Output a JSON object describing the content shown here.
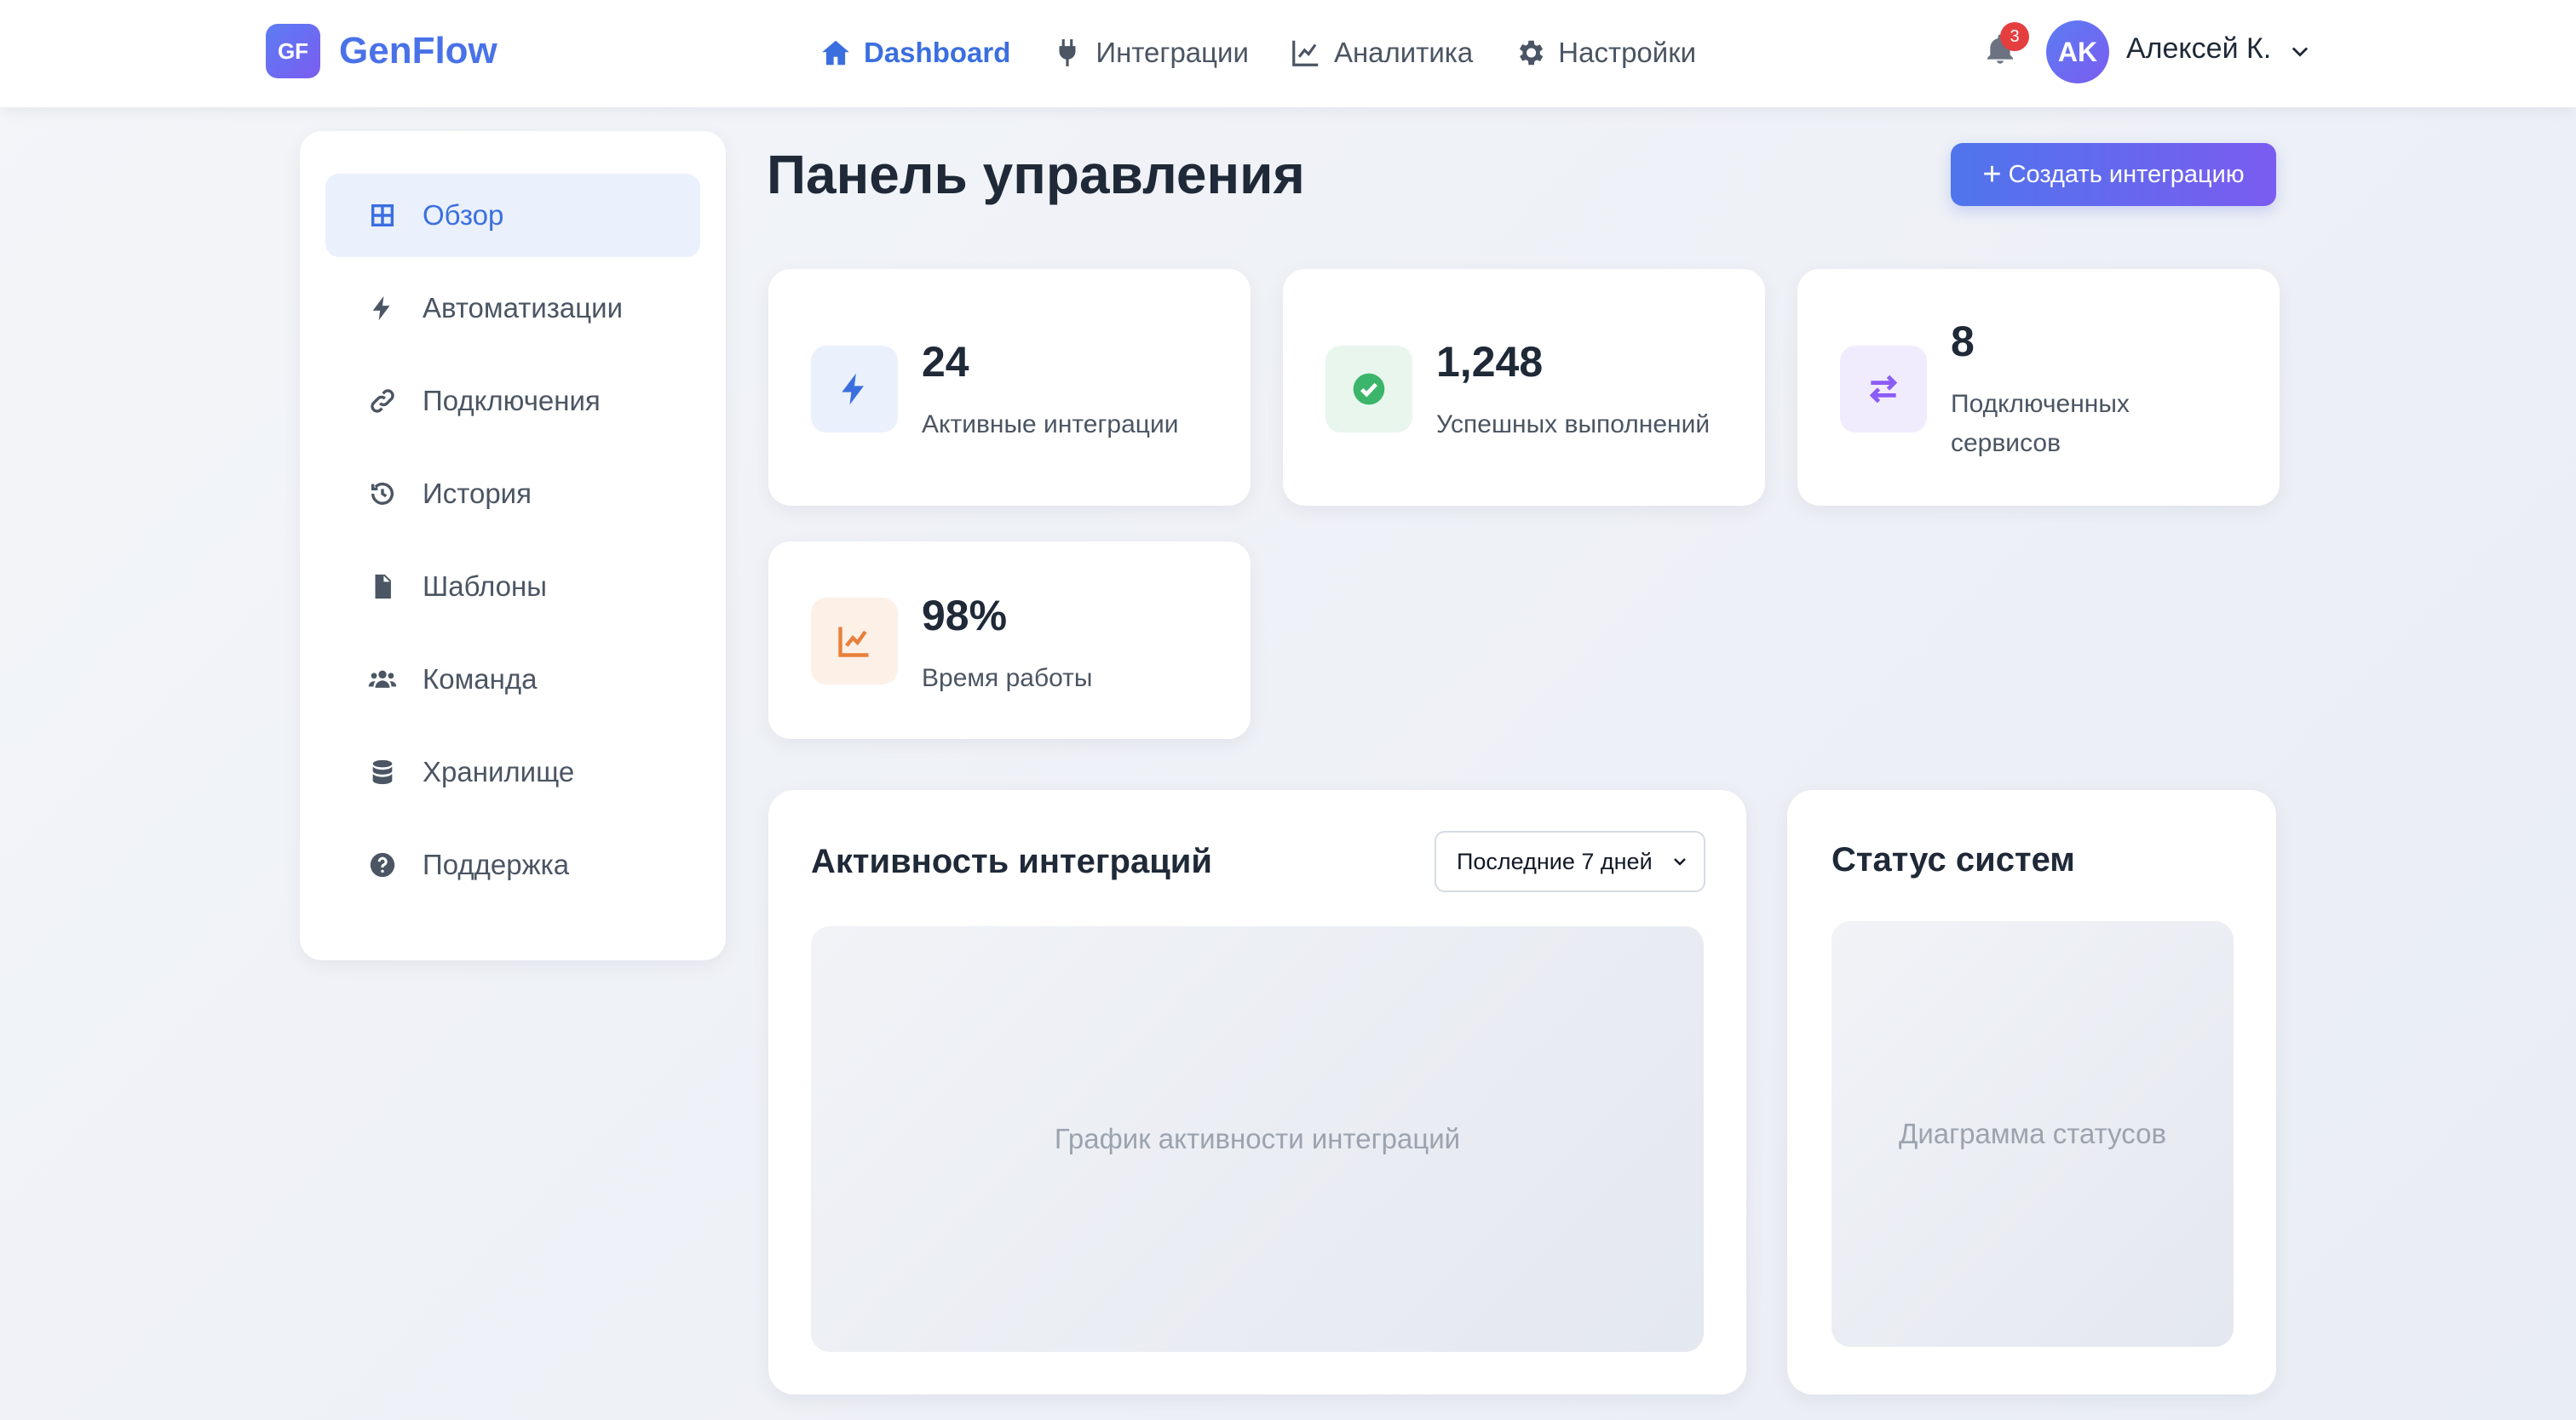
{
  "brand": {
    "logo_text": "GF",
    "name": "GenFlow"
  },
  "nav": {
    "items": [
      {
        "label": "Dashboard",
        "icon": "home-icon",
        "active": true
      },
      {
        "label": "Интеграции",
        "icon": "plug-icon",
        "active": false
      },
      {
        "label": "Аналитика",
        "icon": "chart-line-icon",
        "active": false
      },
      {
        "label": "Настройки",
        "icon": "gear-icon",
        "active": false
      }
    ]
  },
  "header": {
    "notifications_count": "3",
    "user_initials": "AK",
    "user_name": "Алексей К."
  },
  "sidebar": {
    "items": [
      {
        "label": "Обзор",
        "icon": "grid-icon",
        "active": true
      },
      {
        "label": "Автоматизации",
        "icon": "bolt-icon",
        "active": false
      },
      {
        "label": "Подключения",
        "icon": "link-icon",
        "active": false
      },
      {
        "label": "История",
        "icon": "history-icon",
        "active": false
      },
      {
        "label": "Шаблоны",
        "icon": "document-icon",
        "active": false
      },
      {
        "label": "Команда",
        "icon": "users-icon",
        "active": false
      },
      {
        "label": "Хранилище",
        "icon": "database-icon",
        "active": false
      },
      {
        "label": "Поддержка",
        "icon": "question-icon",
        "active": false
      }
    ]
  },
  "main": {
    "title": "Панель управления",
    "create_button": "Создать интеграцию",
    "stats": [
      {
        "value": "24",
        "label": "Активные интеграции",
        "icon": "bolt-icon",
        "color": "#3b6fe0"
      },
      {
        "value": "1,248",
        "label": "Успешных выполнений",
        "icon": "check-circle-icon",
        "color": "#3bb56a"
      },
      {
        "value": "8",
        "label": "Подключенных сервисов",
        "icon": "exchange-icon",
        "color": "#8b5cf6"
      },
      {
        "value": "98%",
        "label": "Время работы",
        "icon": "chart-line-icon",
        "color": "#e8803a"
      }
    ],
    "activity": {
      "title": "Активность интеграций",
      "range_selected": "Последние 7 дней",
      "placeholder": "График активности интеграций"
    },
    "status": {
      "title": "Статус систем",
      "placeholder": "Диаграмма статусов"
    }
  },
  "colors": {
    "accent": "#3b6fe0",
    "brand_gradient_start": "#5b7df3",
    "brand_gradient_end": "#7b5cf0",
    "badge": "#e53e3e"
  }
}
